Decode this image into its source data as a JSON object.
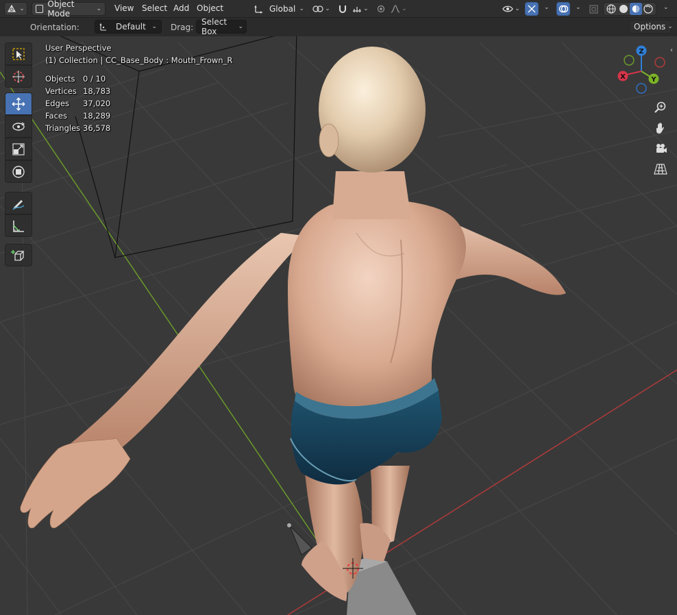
{
  "header": {
    "editor_type_icon": "object-mesh-icon",
    "mode_label": "Object Mode",
    "menus": [
      "View",
      "Select",
      "Add",
      "Object"
    ],
    "transform_orientation": "Global",
    "shading_modes": [
      "wireframe",
      "solid",
      "material-preview",
      "rendered"
    ],
    "active_shading": "material-preview"
  },
  "tool_settings": {
    "orientation_label": "Orientation:",
    "orientation_value": "Default",
    "drag_label": "Drag:",
    "drag_value": "Select Box",
    "options_label": "Options"
  },
  "overlay": {
    "view_name": "User Perspective",
    "context": "(1) Collection | CC_Base_Body : Mouth_Frown_R",
    "stats": [
      {
        "label": "Objects",
        "value": "0 / 10"
      },
      {
        "label": "Vertices",
        "value": "18,783"
      },
      {
        "label": "Edges",
        "value": "37,020"
      },
      {
        "label": "Faces",
        "value": "18,289"
      },
      {
        "label": "Triangles",
        "value": "36,578"
      }
    ]
  },
  "toolbar": {
    "tools": [
      "select-box",
      "cursor",
      "move",
      "rotate",
      "scale",
      "transform",
      "annotate",
      "measure",
      "add-cube"
    ],
    "active_tool": "move"
  },
  "gizmo": {
    "axes": [
      "Z",
      "Y",
      "X"
    ],
    "colors": {
      "x": "#d6354a",
      "y": "#7cb326",
      "z": "#2f7fd8"
    }
  },
  "colors": {
    "accent": "#4772b3",
    "viewport_bg": "#393939",
    "grid_line": "#4a4a4a",
    "x_axis": "#b03a3a",
    "y_axis": "#6a9a2a",
    "skin": "#d9ad94",
    "shorts": "#173d54"
  }
}
